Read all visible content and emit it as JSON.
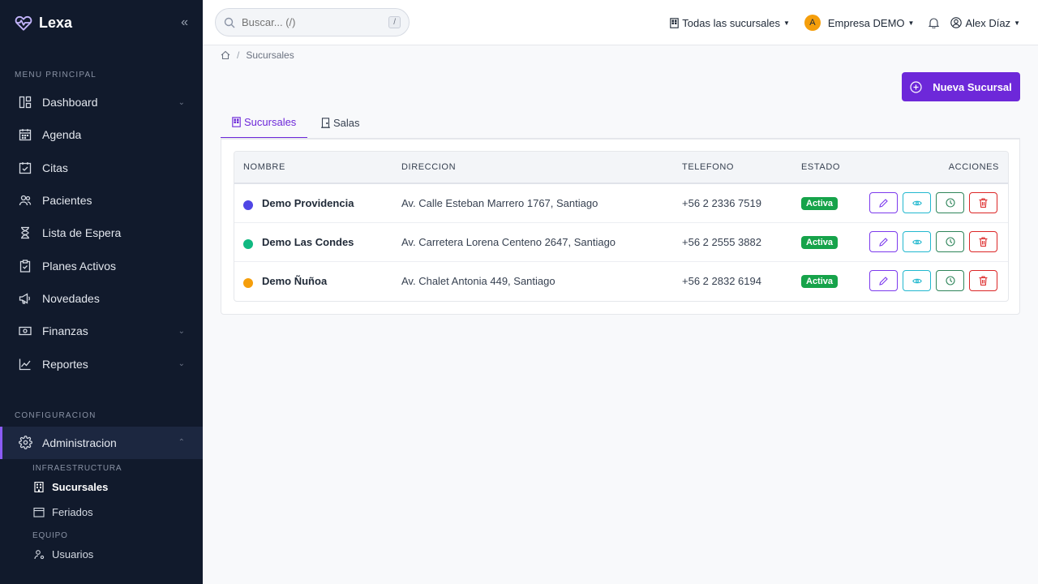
{
  "app": {
    "name": "Lexa"
  },
  "sidebar": {
    "main_section": "MENU PRINCIPAL",
    "items": [
      {
        "label": "Dashboard",
        "icon": "dashboard-icon",
        "has_chevron": true
      },
      {
        "label": "Agenda",
        "icon": "calendar-icon",
        "has_chevron": false
      },
      {
        "label": "Citas",
        "icon": "calendar-check-icon",
        "has_chevron": false
      },
      {
        "label": "Pacientes",
        "icon": "users-icon",
        "has_chevron": false
      },
      {
        "label": "Lista de Espera",
        "icon": "hourglass-icon",
        "has_chevron": false
      },
      {
        "label": "Planes Activos",
        "icon": "clipboard-check-icon",
        "has_chevron": false
      },
      {
        "label": "Novedades",
        "icon": "megaphone-icon",
        "has_chevron": false
      },
      {
        "label": "Finanzas",
        "icon": "cash-icon",
        "has_chevron": true
      },
      {
        "label": "Reportes",
        "icon": "chart-line-icon",
        "has_chevron": true
      }
    ],
    "config_section": "CONFIGURACION",
    "admin": {
      "label": "Administracion",
      "icon": "gear-icon"
    },
    "infra_title": "INFRAESTRUCTURA",
    "infra_items": [
      {
        "label": "Sucursales",
        "icon": "building-icon",
        "active": true
      },
      {
        "label": "Feriados",
        "icon": "calendar-icon",
        "active": false
      }
    ],
    "team_title": "EQUIPO",
    "team_items": [
      {
        "label": "Usuarios",
        "icon": "user-gear-icon",
        "active": false
      }
    ]
  },
  "topbar": {
    "search_placeholder": "Buscar... (/)",
    "search_shortcut": "/",
    "branch_selector": "Todas las sucursales",
    "company_initial": "A",
    "company_name": "Empresa DEMO",
    "user_name": "Alex Díaz"
  },
  "breadcrumb": {
    "current": "Sucursales"
  },
  "new_button": "Nueva Sucursal",
  "tabs": [
    {
      "label": "Sucursales",
      "icon": "building-icon",
      "active": true
    },
    {
      "label": "Salas",
      "icon": "door-icon",
      "active": false
    }
  ],
  "table": {
    "headers": {
      "name": "NOMBRE",
      "address": "DIRECCION",
      "phone": "TELEFONO",
      "status": "ESTADO",
      "actions": "ACCIONES"
    },
    "rows": [
      {
        "name": "Demo Providencia",
        "address": "Av. Calle Esteban Marrero 1767, Santiago",
        "phone": "+56 2 2336 7519",
        "status": "Activa",
        "color": "#4f46e5"
      },
      {
        "name": "Demo Las Condes",
        "address": "Av. Carretera Lorena Centeno 2647, Santiago",
        "phone": "+56 2 2555 3882",
        "status": "Activa",
        "color": "#10b981"
      },
      {
        "name": "Demo Ñuñoa",
        "address": "Av. Chalet Antonia 449, Santiago",
        "phone": "+56 2 2832 6194",
        "status": "Activa",
        "color": "#f59e0b"
      }
    ]
  },
  "colors": {
    "sidebar_bg": "#111a2c",
    "accent": "#6d28d9",
    "status_active": "#16a34a"
  }
}
